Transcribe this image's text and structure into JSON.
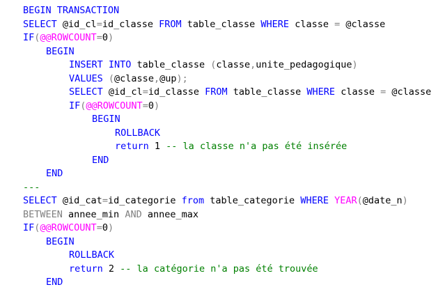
{
  "colors": {
    "keyword": "#0000ff",
    "function": "#ff00ff",
    "operator": "#808080",
    "comment": "#008000",
    "text": "#000000"
  },
  "code": {
    "lines": [
      {
        "indent": 0,
        "tokens": [
          {
            "c": "kw",
            "t": "BEGIN TRANSACTION"
          }
        ]
      },
      {
        "indent": 0,
        "tokens": [
          {
            "c": "kw",
            "t": "SELECT "
          },
          {
            "c": "tx",
            "t": "@id_cl"
          },
          {
            "c": "op",
            "t": "="
          },
          {
            "c": "tx",
            "t": "id_classe "
          },
          {
            "c": "kw",
            "t": "FROM "
          },
          {
            "c": "tx",
            "t": "table_classe "
          },
          {
            "c": "kw",
            "t": "WHERE "
          },
          {
            "c": "tx",
            "t": "classe "
          },
          {
            "c": "op",
            "t": "= "
          },
          {
            "c": "tx",
            "t": "@classe"
          }
        ]
      },
      {
        "indent": 0,
        "tokens": [
          {
            "c": "kw",
            "t": "IF"
          },
          {
            "c": "op",
            "t": "("
          },
          {
            "c": "fn",
            "t": "@@ROWCOUNT"
          },
          {
            "c": "op",
            "t": "="
          },
          {
            "c": "tx",
            "t": "0"
          },
          {
            "c": "op",
            "t": ")"
          }
        ]
      },
      {
        "indent": 1,
        "tokens": [
          {
            "c": "kw",
            "t": "BEGIN"
          }
        ]
      },
      {
        "indent": 2,
        "tokens": [
          {
            "c": "kw",
            "t": "INSERT INTO "
          },
          {
            "c": "tx",
            "t": "table_classe "
          },
          {
            "c": "op",
            "t": "("
          },
          {
            "c": "tx",
            "t": "classe"
          },
          {
            "c": "op",
            "t": ","
          },
          {
            "c": "tx",
            "t": "unite_pedagogique"
          },
          {
            "c": "op",
            "t": ")"
          }
        ]
      },
      {
        "indent": 2,
        "tokens": [
          {
            "c": "kw",
            "t": "VALUES "
          },
          {
            "c": "op",
            "t": "("
          },
          {
            "c": "tx",
            "t": "@classe"
          },
          {
            "c": "op",
            "t": ","
          },
          {
            "c": "tx",
            "t": "@up"
          },
          {
            "c": "op",
            "t": ");"
          }
        ]
      },
      {
        "indent": 2,
        "tokens": [
          {
            "c": "kw",
            "t": "SELECT "
          },
          {
            "c": "tx",
            "t": "@id_cl"
          },
          {
            "c": "op",
            "t": "="
          },
          {
            "c": "tx",
            "t": "id_classe "
          },
          {
            "c": "kw",
            "t": "FROM "
          },
          {
            "c": "tx",
            "t": "table_classe "
          },
          {
            "c": "kw",
            "t": "WHERE "
          },
          {
            "c": "tx",
            "t": "classe "
          },
          {
            "c": "op",
            "t": "= "
          },
          {
            "c": "tx",
            "t": "@classe"
          }
        ]
      },
      {
        "indent": 2,
        "tokens": [
          {
            "c": "kw",
            "t": "IF"
          },
          {
            "c": "op",
            "t": "("
          },
          {
            "c": "fn",
            "t": "@@ROWCOUNT"
          },
          {
            "c": "op",
            "t": "="
          },
          {
            "c": "tx",
            "t": "0"
          },
          {
            "c": "op",
            "t": ")"
          }
        ]
      },
      {
        "indent": 3,
        "tokens": [
          {
            "c": "kw",
            "t": "BEGIN"
          }
        ]
      },
      {
        "indent": 4,
        "tokens": [
          {
            "c": "kw",
            "t": "ROLLBACK"
          }
        ]
      },
      {
        "indent": 4,
        "tokens": [
          {
            "c": "kw",
            "t": "return "
          },
          {
            "c": "tx",
            "t": "1 "
          },
          {
            "c": "cm",
            "t": "-- la classe n'a pas été insérée"
          }
        ]
      },
      {
        "indent": 3,
        "tokens": [
          {
            "c": "kw",
            "t": "END"
          }
        ]
      },
      {
        "indent": 1,
        "tokens": [
          {
            "c": "kw",
            "t": "END"
          }
        ]
      },
      {
        "indent": 0,
        "tokens": [
          {
            "c": "cm",
            "t": "---"
          }
        ]
      },
      {
        "indent": 0,
        "tokens": [
          {
            "c": "kw",
            "t": "SELECT "
          },
          {
            "c": "tx",
            "t": "@id_cat"
          },
          {
            "c": "op",
            "t": "="
          },
          {
            "c": "tx",
            "t": "id_categorie "
          },
          {
            "c": "kw",
            "t": "from "
          },
          {
            "c": "tx",
            "t": "table_categorie "
          },
          {
            "c": "kw",
            "t": "WHERE "
          },
          {
            "c": "fn",
            "t": "YEAR"
          },
          {
            "c": "op",
            "t": "("
          },
          {
            "c": "tx",
            "t": "@date_n"
          },
          {
            "c": "op",
            "t": ")"
          }
        ]
      },
      {
        "indent": 0,
        "tokens": [
          {
            "c": "op",
            "t": "BETWEEN "
          },
          {
            "c": "tx",
            "t": "annee_min "
          },
          {
            "c": "op",
            "t": "AND "
          },
          {
            "c": "tx",
            "t": "annee_max"
          }
        ]
      },
      {
        "indent": 0,
        "tokens": [
          {
            "c": "kw",
            "t": "IF"
          },
          {
            "c": "op",
            "t": "("
          },
          {
            "c": "fn",
            "t": "@@ROWCOUNT"
          },
          {
            "c": "op",
            "t": "="
          },
          {
            "c": "tx",
            "t": "0"
          },
          {
            "c": "op",
            "t": ")"
          }
        ]
      },
      {
        "indent": 1,
        "tokens": [
          {
            "c": "kw",
            "t": "BEGIN"
          }
        ]
      },
      {
        "indent": 2,
        "tokens": [
          {
            "c": "kw",
            "t": "ROLLBACK"
          }
        ]
      },
      {
        "indent": 2,
        "tokens": [
          {
            "c": "kw",
            "t": "return "
          },
          {
            "c": "tx",
            "t": "2 "
          },
          {
            "c": "cm",
            "t": "-- la catégorie n'a pas été trouvée"
          }
        ]
      },
      {
        "indent": 1,
        "tokens": [
          {
            "c": "kw",
            "t": "END"
          }
        ]
      }
    ]
  }
}
